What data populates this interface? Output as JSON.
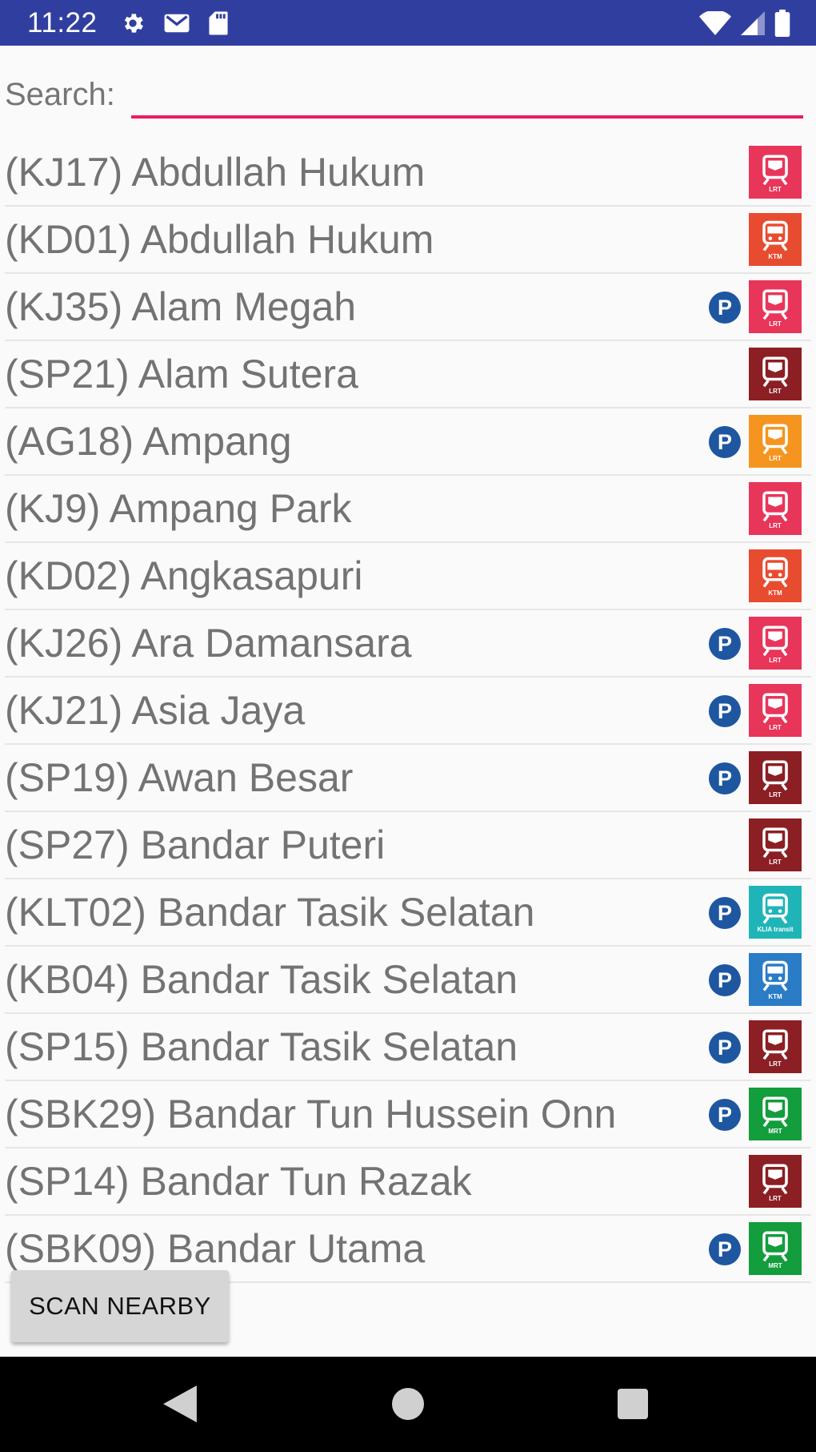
{
  "status_bar": {
    "time": "11:22",
    "icons": [
      "settings-icon",
      "gmail-icon",
      "sd-card-icon",
      "wifi-icon",
      "signal-icon",
      "battery-icon"
    ]
  },
  "search": {
    "label": "Search:",
    "value": "",
    "placeholder": ""
  },
  "stations": [
    {
      "name": "(KJ17) Abdullah Hukum",
      "parking": false,
      "line": "LRT",
      "color": "#e8355a"
    },
    {
      "name": "(KD01) Abdullah Hukum",
      "parking": false,
      "line": "KTM",
      "color": "#e84c30"
    },
    {
      "name": "(KJ35) Alam Megah",
      "parking": true,
      "line": "LRT",
      "color": "#e8355a"
    },
    {
      "name": "(SP21) Alam Sutera",
      "parking": false,
      "line": "LRT",
      "color": "#8b1f24"
    },
    {
      "name": "(AG18) Ampang",
      "parking": true,
      "line": "LRT",
      "color": "#f5951f"
    },
    {
      "name": "(KJ9) Ampang Park",
      "parking": false,
      "line": "LRT",
      "color": "#e8355a"
    },
    {
      "name": "(KD02) Angkasapuri",
      "parking": false,
      "line": "KTM",
      "color": "#e84c30"
    },
    {
      "name": "(KJ26) Ara Damansara",
      "parking": true,
      "line": "LRT",
      "color": "#e8355a"
    },
    {
      "name": "(KJ21) Asia Jaya",
      "parking": true,
      "line": "LRT",
      "color": "#e8355a"
    },
    {
      "name": "(SP19) Awan Besar",
      "parking": true,
      "line": "LRT",
      "color": "#8b1f24"
    },
    {
      "name": "(SP27) Bandar Puteri",
      "parking": false,
      "line": "LRT",
      "color": "#8b1f24"
    },
    {
      "name": "(KLT02) Bandar Tasik Selatan",
      "parking": true,
      "line": "KLIA transit",
      "color": "#1fb5b8"
    },
    {
      "name": "(KB04) Bandar Tasik Selatan",
      "parking": true,
      "line": "KTM",
      "color": "#2a7cc7"
    },
    {
      "name": "(SP15) Bandar Tasik Selatan",
      "parking": true,
      "line": "LRT",
      "color": "#8b1f24"
    },
    {
      "name": "(SBK29) Bandar Tun Hussein Onn",
      "parking": true,
      "line": "MRT",
      "color": "#139d3c"
    },
    {
      "name": "(SP14) Bandar Tun Razak",
      "parking": false,
      "line": "LRT",
      "color": "#8b1f24"
    },
    {
      "name": "(SBK09) Bandar Utama",
      "parking": true,
      "line": "MRT",
      "color": "#139d3c"
    }
  ],
  "parking_label": "P",
  "scan_button": {
    "label": "SCAN NEARBY"
  },
  "nav_bar": {
    "icons": [
      "back-icon",
      "home-icon",
      "recents-icon"
    ]
  },
  "accent_color": "#e91e63",
  "status_bar_color": "#303f9f"
}
